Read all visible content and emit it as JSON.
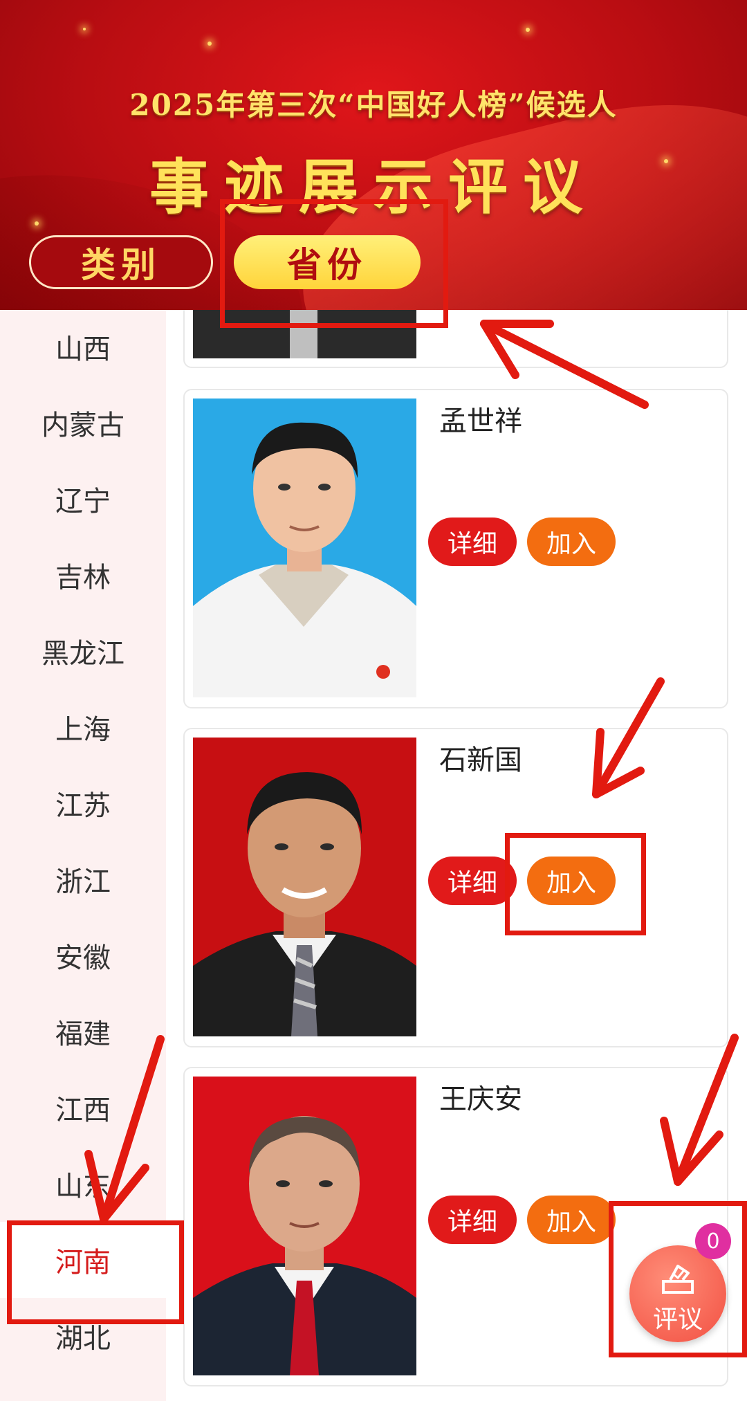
{
  "banner": {
    "line1": "2025年第三次“中国好人榜”候选人",
    "line2": "事迹展示评议"
  },
  "tabs": {
    "category": "类别",
    "province": "省份",
    "active": "province"
  },
  "sidebar": {
    "items": [
      "山西",
      "内蒙古",
      "辽宁",
      "吉林",
      "黑龙江",
      "上海",
      "江苏",
      "浙江",
      "安徽",
      "福建",
      "江西",
      "山东",
      "河南",
      "湖北"
    ],
    "active": "河南"
  },
  "buttons": {
    "detail": "详细",
    "join": "加入"
  },
  "candidates": [
    {
      "name": "孟世祥",
      "photo_bg": "#2aa9e6"
    },
    {
      "name": "石新国",
      "photo_bg": "#c70f12"
    },
    {
      "name": "王庆安",
      "photo_bg": "#d9101a"
    }
  ],
  "fab": {
    "label": "评议",
    "badge": "0",
    "icon": "ballot-box-icon"
  },
  "colors": {
    "accent_red": "#e11a1a",
    "join_orange": "#f36d10",
    "annotation_red": "#e21a10",
    "banner_gold": "#ffe36b"
  }
}
